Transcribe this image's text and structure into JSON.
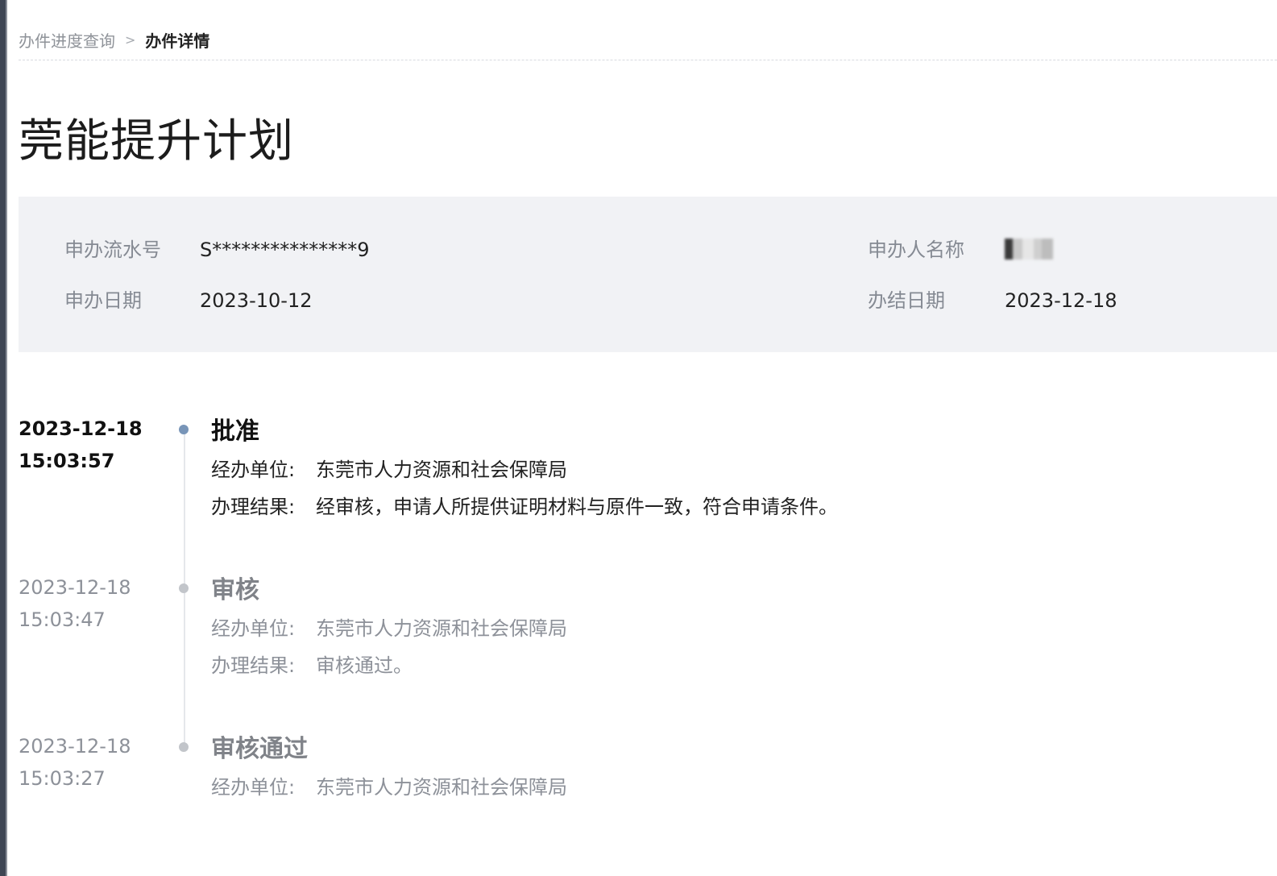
{
  "breadcrumb": {
    "parent": "办件进度查询",
    "separator": ">",
    "current": "办件详情"
  },
  "title": "莞能提升计划",
  "info": {
    "serial_label": "申办流水号",
    "serial_value": "S***************9",
    "applicant_label": "申办人名称",
    "applicant_value": "",
    "apply_date_label": "申办日期",
    "apply_date_value": "2023-10-12",
    "close_date_label": "办结日期",
    "close_date_value": "2023-12-18"
  },
  "timeline": [
    {
      "date": "2023-12-18",
      "time": "15:03:57",
      "title": "批准",
      "unit_label": "经办单位:",
      "unit_value": "东莞市人力资源和社会保障局",
      "result_label": "办理结果:",
      "result_value": "经审核，申请人所提供证明材料与原件一致，符合申请条件。"
    },
    {
      "date": "2023-12-18",
      "time": "15:03:47",
      "title": "审核",
      "unit_label": "经办单位:",
      "unit_value": "东莞市人力资源和社会保障局",
      "result_label": "办理结果:",
      "result_value": "审核通过。"
    },
    {
      "date": "2023-12-18",
      "time": "15:03:27",
      "title": "审核通过",
      "unit_label": "经办单位:",
      "unit_value": "东莞市人力资源和社会保障局"
    }
  ],
  "colors": {
    "panel_bg": "#f1f2f5",
    "active_dot": "#7895b8",
    "inactive_dot": "#c2c5ca",
    "muted_text": "#8d9199"
  }
}
